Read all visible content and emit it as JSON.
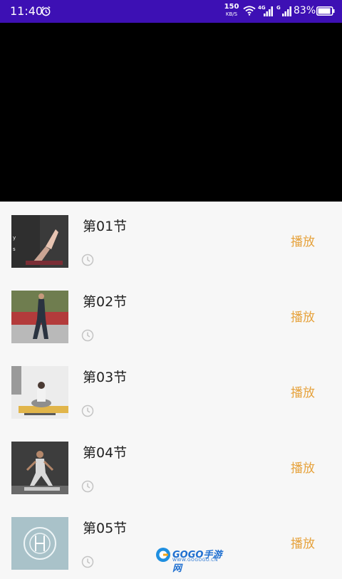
{
  "status_bar": {
    "time": "11:40",
    "net_speed_value": "150",
    "net_speed_unit": "KB/S",
    "signal1_label": "4G",
    "signal2_label": "G",
    "battery": "83%",
    "icons": [
      "alarm-icon",
      "wifi-icon",
      "signal-icon",
      "signal-icon",
      "battery-icon"
    ]
  },
  "video_player": {},
  "lessons": [
    {
      "title": "第01节",
      "action": "播放"
    },
    {
      "title": "第02节",
      "action": "播放"
    },
    {
      "title": "第03节",
      "action": "播放"
    },
    {
      "title": "第04节",
      "action": "播放"
    },
    {
      "title": "第05节",
      "action": "播放"
    }
  ],
  "watermark": {
    "brand": "GOGO手游网",
    "url": "WWW.GOGOGO.CN"
  },
  "colors": {
    "status_bar": "#3d10b4",
    "play_text": "#e6a23c",
    "list_background": "#f7f7f7",
    "video_background": "#000000"
  }
}
